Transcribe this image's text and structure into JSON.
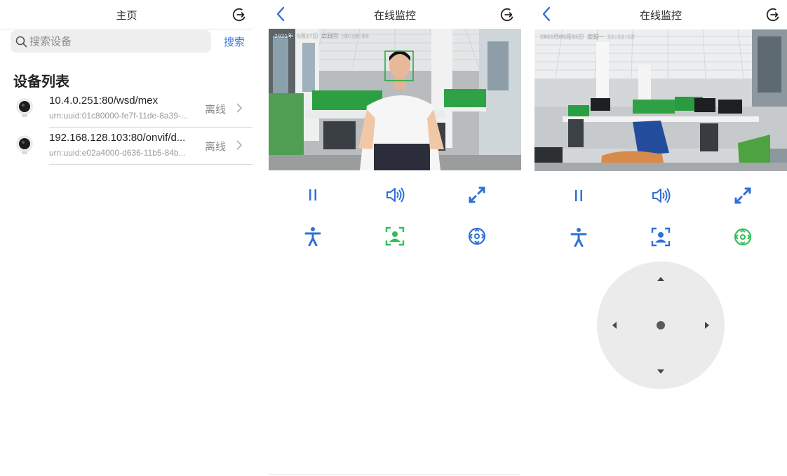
{
  "home": {
    "title": "主页",
    "search": {
      "placeholder": "搜索设备",
      "button_label": "搜索"
    },
    "section_title": "设备列表",
    "devices": [
      {
        "name": "10.4.0.251:80/wsd/mex",
        "id": "urn:uuid:01c80000-fe7f-11de-8a39-...",
        "status": "离线"
      },
      {
        "name": "192.168.128.103:80/onvif/d...",
        "id": "urn:uuid:e02a4000-d636-11b5-84b...",
        "status": "离线"
      }
    ]
  },
  "monitor_face": {
    "title": "在线监控",
    "osd": "2021年 5月27日 星期四 10:19:54"
  },
  "monitor_ptz": {
    "title": "在线监控",
    "osd": "2021年05月31日 星期一 11:11:12"
  },
  "icons": {
    "back": "chevron-left-icon",
    "logout": "logout-icon",
    "pause": "pause-icon",
    "volume": "volume-icon",
    "fullscreen": "fullscreen-icon",
    "human_detect": "person-icon",
    "face_detect": "face-frame-icon",
    "ptz": "ptz-control-icon"
  },
  "colors": {
    "accent": "#2f6fd6",
    "active_green": "#2fbf5a",
    "face_box": "#1ea934",
    "ptz_pad": "#ebebeb"
  }
}
